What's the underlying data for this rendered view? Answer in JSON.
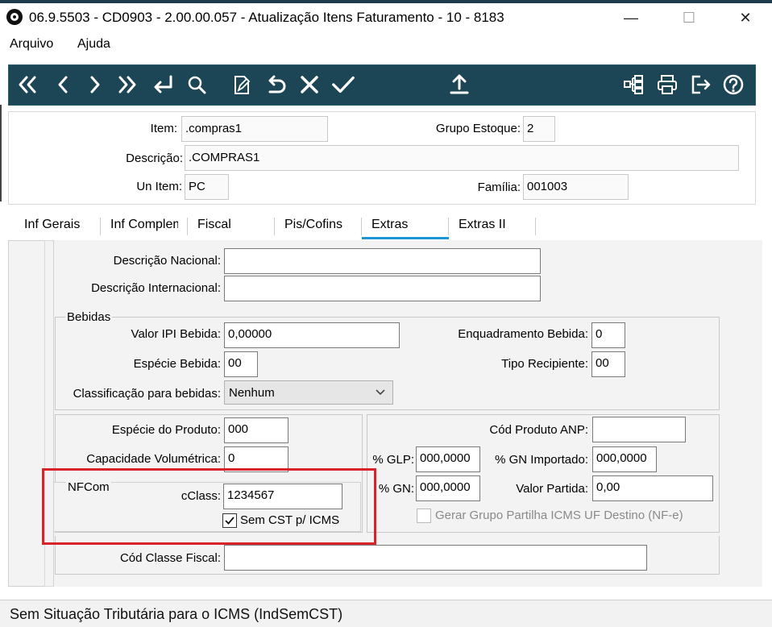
{
  "window": {
    "title": "06.9.5503 - CD0903 - 2.00.00.057 - Atualização Itens Faturamento - 10 - 8183",
    "minimize_glyph": "—",
    "maximize_glyph": "☐",
    "close_glyph": "✕"
  },
  "menu": [
    "Arquivo",
    "Ajuda"
  ],
  "toolbar": {
    "left_icons": [
      "first-record-icon",
      "previous-record-icon",
      "next-record-icon",
      "last-record-icon",
      "return-icon",
      "search-icon",
      "edit-icon",
      "undo-icon",
      "cancel-icon",
      "confirm-icon"
    ],
    "center_icons": [
      "upload-icon"
    ],
    "right_icons": [
      "hierarchy-icon",
      "print-icon",
      "exit-icon",
      "help-icon"
    ],
    "color": "#1c4555"
  },
  "header": {
    "item_label": "Item:",
    "item_value": ".compras1",
    "grupo_estoque_label": "Grupo Estoque:",
    "grupo_estoque_value": "2",
    "descricao_label": "Descrição:",
    "descricao_value": ".COMPRAS1",
    "un_item_label": "Un Item:",
    "un_item_value": "PC",
    "familia_label": "Família:",
    "familia_value": "001003"
  },
  "tabs": [
    {
      "label": "Inf Gerais"
    },
    {
      "label": "Inf Complem"
    },
    {
      "label": "Fiscal"
    },
    {
      "label": "Pis/Cofins"
    },
    {
      "label": "Extras"
    },
    {
      "label": "Extras II"
    }
  ],
  "active_tab": "Extras",
  "extras": {
    "descricao_nacional_label": "Descrição Nacional:",
    "descricao_nacional_value": "",
    "descricao_internacional_label": "Descrição Internacional:",
    "descricao_internacional_value": "",
    "bebidas": {
      "legend": "Bebidas",
      "valor_ipi_label": "Valor IPI Bebida:",
      "valor_ipi_value": "0,00000",
      "enquadramento_label": "Enquadramento Bebida:",
      "enquadramento_value": "0",
      "especie_label": "Espécie Bebida:",
      "especie_value": "00",
      "tipo_recipiente_label": "Tipo Recipiente:",
      "tipo_recipiente_value": "00",
      "classificacao_label": "Classificação para bebidas:",
      "classificacao_value": "Nenhum"
    },
    "produto": {
      "especie_produto_label": "Espécie do Produto:",
      "especie_produto_value": "000",
      "capacidade_label": "Capacidade Volumétrica:",
      "capacidade_value": "0"
    },
    "nfcom": {
      "legend": "NFCom",
      "cclass_label": "cClass:",
      "cclass_value": "1234567",
      "sem_cst_label": "Sem CST p/ ICMS",
      "sem_cst_checked": true
    },
    "anp": {
      "cod_produto_label": "Cód Produto ANP:",
      "cod_produto_value": "",
      "glp_label": "% GLP:",
      "glp_value": "000,0000",
      "gn_importado_label": "% GN Importado:",
      "gn_importado_value": "000,0000",
      "gn_label": "% GN:",
      "gn_value": "000,0000",
      "valor_partida_label": "Valor Partida:",
      "valor_partida_value": "0,00",
      "gerar_grupo_label": "Gerar Grupo Partilha ICMS UF Destino (NF-e)",
      "gerar_grupo_checked": false
    },
    "cod_classe_fiscal_label": "Cód Classe Fiscal:",
    "cod_classe_fiscal_value": ""
  },
  "status": {
    "text": "Sem Situação Tributária para o ICMS (IndSemCST)"
  },
  "colors": {
    "toolbar_bg": "#1c4555",
    "active_tab_underline": "#1a96d6",
    "highlight_box": "#d9232a"
  }
}
